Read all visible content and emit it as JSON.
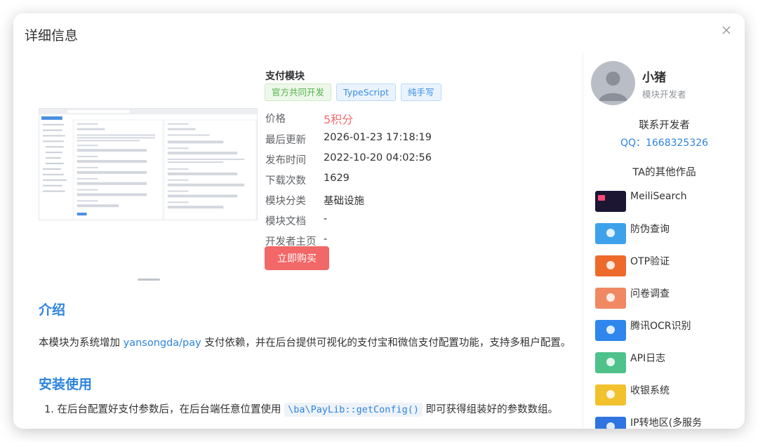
{
  "dialog": {
    "title": "详细信息"
  },
  "module": {
    "title": "支付模块",
    "tags": [
      "官方共同开发",
      "TypeScript",
      "纯手写"
    ],
    "info": [
      {
        "key": "价格",
        "value": "5积分"
      },
      {
        "key": "最后更新",
        "value": "2026-01-23 17:18:19"
      },
      {
        "key": "发布时间",
        "value": "2022-10-20 04:02:56"
      },
      {
        "key": "下载次数",
        "value": "1629"
      },
      {
        "key": "模块分类",
        "value": "基础设施"
      },
      {
        "key": "模块文档",
        "value": "-"
      },
      {
        "key": "开发者主页",
        "value": "-"
      }
    ],
    "buy_label": "立即购买"
  },
  "intro": {
    "heading": "介绍",
    "text_before": "本模块为系统增加 ",
    "link": "yansongda/pay",
    "text_after": " 支付依赖，并在后台提供可视化的支付宝和微信支付配置功能，支持多租户配置。"
  },
  "install": {
    "heading": "安装使用",
    "step1_num": "1.",
    "step1_before": "在后台配置好支付参数后，在后台端任意位置使用 ",
    "step1_code": "\\ba\\PayLib::getConfig()",
    "step1_after": " 即可获得组装好的参数数组。"
  },
  "developer": {
    "name": "小猪",
    "role": "模块开发者",
    "contact_heading": "联系开发者",
    "qq": "QQ：1668325326",
    "works_heading": "TA的其他作品",
    "works": [
      {
        "label": "MeiliSearch",
        "icon": "meilisearch-thumbnail-icon",
        "color": "#1c1633"
      },
      {
        "label": "防伪查询",
        "icon": "anti-counterfeit-thumbnail-icon",
        "color": "#3da2ea"
      },
      {
        "label": "OTP验证",
        "icon": "otp-thumbnail-icon",
        "color": "#ee6a2c"
      },
      {
        "label": "问卷调查",
        "icon": "survey-thumbnail-icon",
        "color": "#f08963"
      },
      {
        "label": "腾讯OCR识别",
        "icon": "ocr-thumbnail-icon",
        "color": "#2f86ec"
      },
      {
        "label": "API日志",
        "icon": "api-log-thumbnail-icon",
        "color": "#4fc28c"
      },
      {
        "label": "收银系统",
        "icon": "cashier-thumbnail-icon",
        "color": "#f2c12e"
      },
      {
        "label": "IP转地区(多服务",
        "icon": "ip-region-thumbnail-icon",
        "color": "#2f74e0"
      }
    ]
  },
  "colors": {
    "accent": "#2d84de",
    "price": "#f56c6c",
    "buy_button": "#f26767"
  }
}
